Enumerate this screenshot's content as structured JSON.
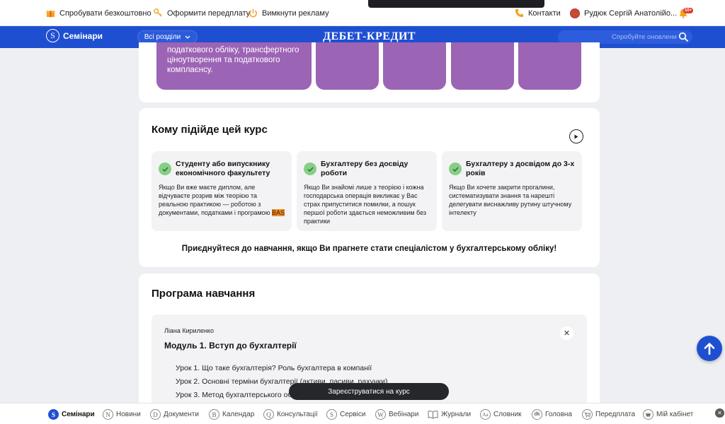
{
  "topbar": {
    "try_free": "Спробувати безкоштовно",
    "subscribe": "Оформити передплату",
    "disable_ads": "Вимкнути рекламу",
    "contacts": "Контакти",
    "user_name": "Рудюк Сергій Анатолійо...",
    "bell_badge": "10+"
  },
  "nav": {
    "section_title": "Семінари",
    "section_icon_letter": "S",
    "all_sections": "Всі розділи",
    "logo": "ДЕБЕТ-КРЕДИТ",
    "search_placeholder": "Спробуйте оновлени"
  },
  "top_card": {
    "purple_text": "податкового обліку, трансфертного ціноутворення та податкового комплаєнсу."
  },
  "audience": {
    "heading": "Кому підійде цей курс",
    "items": [
      {
        "title": "Студенту або випускнику економічного факультету",
        "desc_before": "Якщо Ви вже маєте диплом, але відчуваєте розрив між теорією та реальною практикою — роботою з документами, податками і програмою ",
        "desc_highlight": "BAS"
      },
      {
        "title": "Бухгалтеру без досвіду роботи",
        "desc": "Якщо Ви знайомі лише з теорією і кожна господарська операція викликає у Вас страх припуститися помилки, а пошук першої роботи здається неможливим без практики"
      },
      {
        "title": "Бухгалтеру з досвідом до 3-х років",
        "desc": "Якщо Ви хочете закрити прогалини, систематизувати знання та нарешті делегувати виснажливу рутину штучному інтелекту"
      }
    ],
    "join_text": "Приєднуйтеся до навчання, якщо Ви прагнете стати спеціалістом у бухгалтерському обліку!"
  },
  "program": {
    "heading": "Програма навчання",
    "author": "Ліана Кириленко",
    "module_title": "Модуль 1. Вступ до бухгалтерії",
    "lessons": [
      "Урок 1. Що таке бухгалтерія? Роль бухгалтера в компанії",
      "Урок 2. Основні терміни бухгалтерії (активи, пасиви, рахунки)",
      "Урок 3. Метод бухгалтерського обліку"
    ],
    "register_label": "Зареєструватися на курс"
  },
  "bottom_nav": [
    {
      "label": "Семінари",
      "icon": "S",
      "active": true
    },
    {
      "label": "Новини",
      "icon": "N"
    },
    {
      "label": "Документи",
      "icon": "D"
    },
    {
      "label": "Календар",
      "icon": "B"
    },
    {
      "label": "Консультації",
      "icon": "Q"
    },
    {
      "label": "Сервіси",
      "icon": "S"
    },
    {
      "label": "Вебінари",
      "icon": "W"
    },
    {
      "label": "Журнали",
      "icon": "book"
    },
    {
      "label": "Словник",
      "icon": "Aa"
    },
    {
      "label": "Головна",
      "icon": "dk"
    },
    {
      "label": "Передплата",
      "icon": "cart"
    },
    {
      "label": "Мій кабінет",
      "icon": "cup"
    }
  ],
  "colors": {
    "nav_blue": "#1f4fd1",
    "purple": "#9c64b5",
    "check_green": "#86cf86",
    "highlight_orange": "#f58a1f"
  }
}
